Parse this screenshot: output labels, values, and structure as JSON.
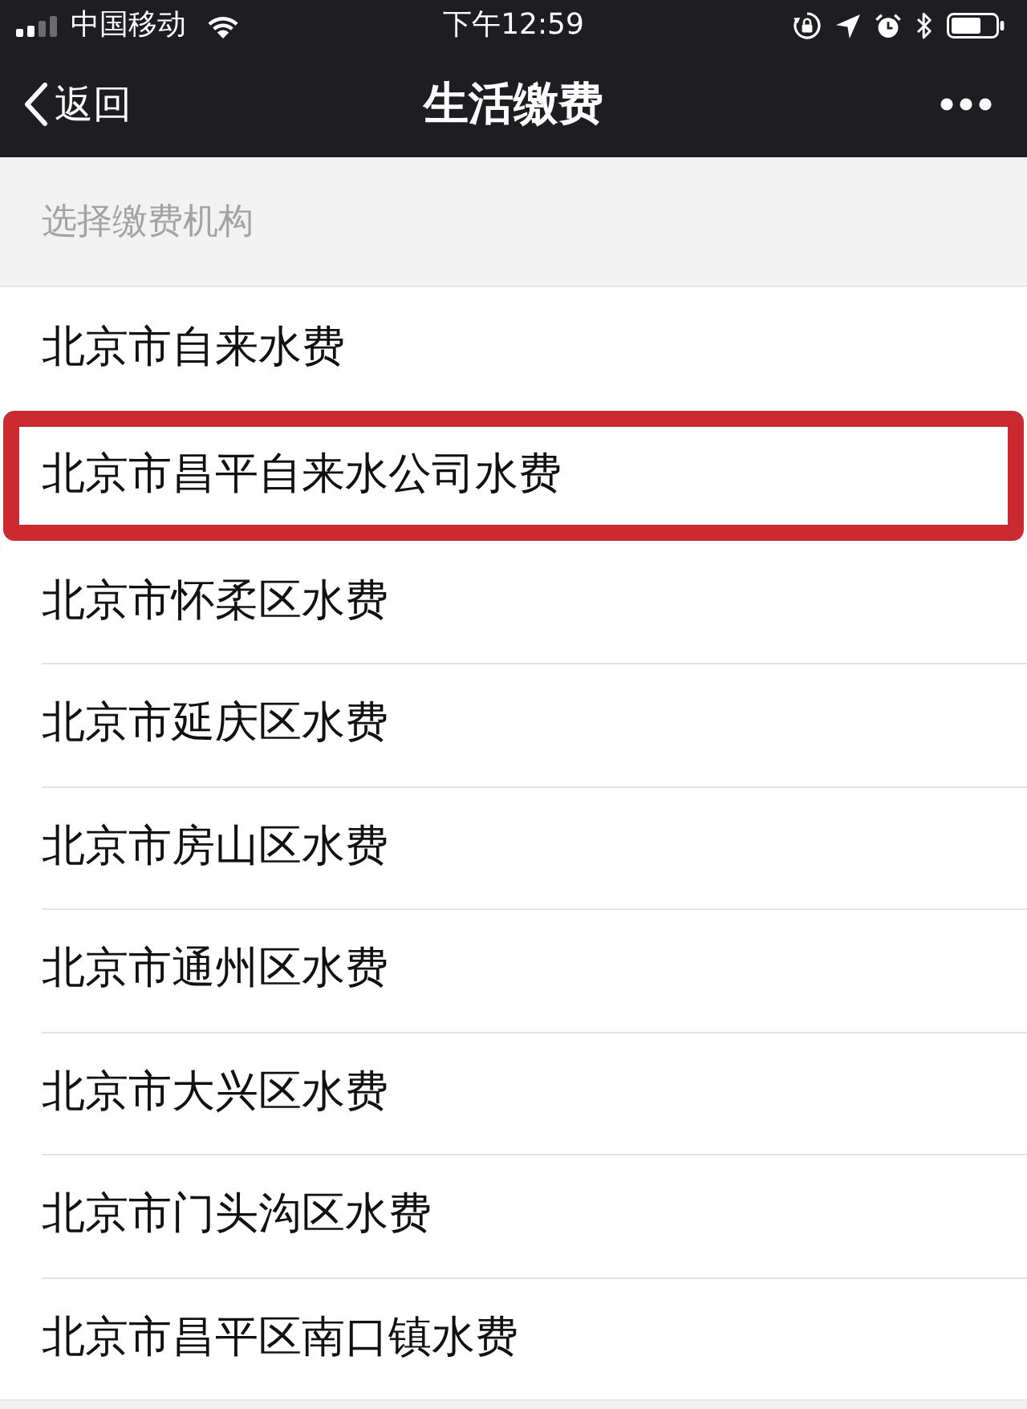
{
  "status_bar": {
    "carrier": "中国移动",
    "time": "下午12:59"
  },
  "nav_bar": {
    "back_label": "返回",
    "title": "生活缴费"
  },
  "section_header": "选择缴费机构",
  "items": [
    {
      "label": "北京市自来水费",
      "highlighted": false
    },
    {
      "label": "北京市昌平自来水公司水费",
      "highlighted": true
    },
    {
      "label": "北京市怀柔区水费",
      "highlighted": false
    },
    {
      "label": "北京市延庆区水费",
      "highlighted": false
    },
    {
      "label": "北京市房山区水费",
      "highlighted": false
    },
    {
      "label": "北京市通州区水费",
      "highlighted": false
    },
    {
      "label": "北京市大兴区水费",
      "highlighted": false
    },
    {
      "label": "北京市门头沟区水费",
      "highlighted": false
    },
    {
      "label": "北京市昌平区南口镇水费",
      "highlighted": false
    }
  ]
}
